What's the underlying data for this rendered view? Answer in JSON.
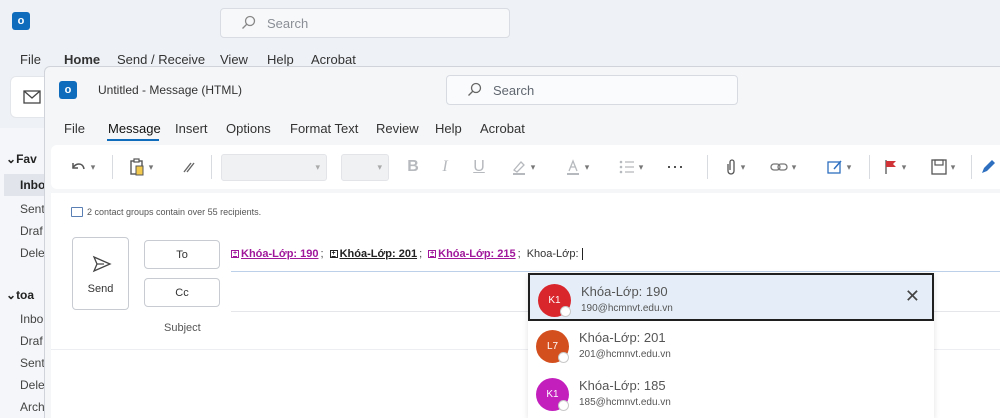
{
  "main_window": {
    "search_placeholder": "Search",
    "menu": [
      "File",
      "Home",
      "Send / Receive",
      "View",
      "Help",
      "Acrobat"
    ],
    "sidebar": {
      "favorites_header": "Fav",
      "favorites": [
        "Inbo",
        "Sent",
        "Draf",
        "Dele"
      ],
      "account_header": "toa",
      "account_items": [
        "Inbo",
        "Draf",
        "Sent",
        "Dele",
        "Arch"
      ]
    }
  },
  "compose": {
    "window_title": "Untitled  -  Message (HTML)",
    "search_placeholder": "Search",
    "tabs": [
      "File",
      "Message",
      "Insert",
      "Options",
      "Format Text",
      "Review",
      "Help",
      "Acrobat"
    ],
    "active_tab": "Message",
    "info_bar": "2 contact groups contain over 55 recipients.",
    "send_label": "Send",
    "to_label": "To",
    "cc_label": "Cc",
    "subject_label": "Subject",
    "to_recipients": [
      {
        "label": "Khóa-Lớp: 190",
        "style": "pink"
      },
      {
        "label": "Khóa-Lớp: 201",
        "style": "dark"
      },
      {
        "label": "Khóa-Lớp: 215",
        "style": "pink"
      }
    ],
    "to_typed": "Khoa-Lớp:"
  },
  "suggestions": [
    {
      "initials": "K1",
      "name": "Khóa-Lớp: 190",
      "email": "190@hcmnvt.edu.vn",
      "color": "#d9262c"
    },
    {
      "initials": "L7",
      "name": "Khóa-Lớp: 201",
      "email": "201@hcmnvt.edu.vn",
      "color": "#d44f1e"
    },
    {
      "initials": "K1",
      "name": "Khóa-Lớp: 185",
      "email": "185@hcmnvt.edu.vn",
      "color": "#c21fbd"
    }
  ],
  "icons": {
    "undo": "undo-icon",
    "paste": "paste-icon",
    "format_painter": "format-painter-icon",
    "bold": "B",
    "italic": "I",
    "underline": "U"
  }
}
